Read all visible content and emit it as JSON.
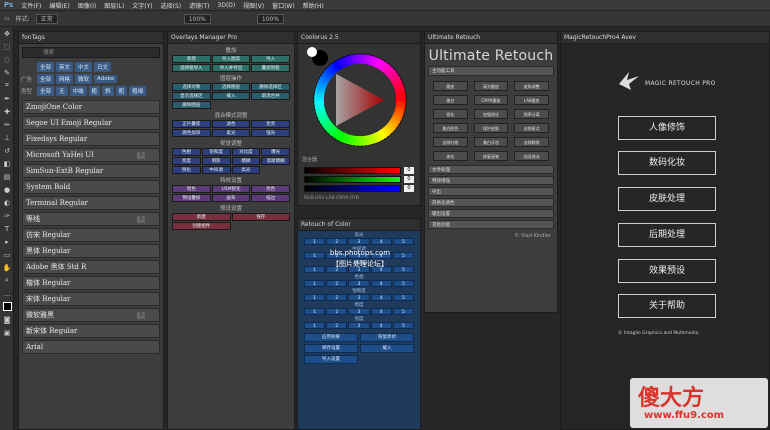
{
  "app": {
    "logo": "Ps"
  },
  "menu": [
    "文件(F)",
    "编辑(E)",
    "图像(I)",
    "图层(L)",
    "文字(Y)",
    "选择(S)",
    "滤镜(T)",
    "3D(D)",
    "视图(V)",
    "窗口(W)",
    "帮助(H)"
  ],
  "options": {
    "size_label": "样式:",
    "size_value": "正常",
    "zoom1": "100%",
    "zoom2": "100%"
  },
  "font_tags": {
    "title": "fonTags",
    "search_placeholder": "搜索",
    "rows": [
      {
        "label": "",
        "tags": [
          "全部",
          "英文",
          "中文",
          "日文"
        ]
      },
      {
        "label": "广告",
        "tags": [
          "全部",
          "网格",
          "微软",
          "Adobe"
        ]
      },
      {
        "label": "类型",
        "tags": [
          "全部",
          "无",
          "中端",
          "粗",
          "斜",
          "粗",
          "粗细"
        ]
      }
    ],
    "fonts": [
      {
        "name": "ZmojiOne Color",
        "badge": ""
      },
      {
        "name": "Segoe UI Emoji Regular",
        "badge": ""
      },
      {
        "name": "Fixedsys Regular",
        "badge": ""
      },
      {
        "name": "Microsoft YaHei UI",
        "badge": "3"
      },
      {
        "name": "SimSun-ExtB Regular",
        "badge": ""
      },
      {
        "name": "System Bold",
        "badge": ""
      },
      {
        "name": "Terminal Regular",
        "badge": ""
      },
      {
        "name": "等线",
        "badge": "3"
      },
      {
        "name": "仿宋 Regular",
        "badge": ""
      },
      {
        "name": "黑体 Regular",
        "badge": ""
      },
      {
        "name": "Adobe 黑体 Std R",
        "badge": ""
      },
      {
        "name": "楷体 Regular",
        "badge": ""
      },
      {
        "name": "宋体 Regular",
        "badge": ""
      },
      {
        "name": "微软雅黑",
        "badge": "3"
      },
      {
        "name": "新宋体 Regular",
        "badge": ""
      },
      {
        "name": "Arial",
        "badge": ""
      }
    ]
  },
  "overlays": {
    "title": "Overlays Manager Pro",
    "sections": [
      {
        "header": "叠加",
        "color": "teal",
        "buttons": [
          "新建",
          "导入图案",
          "导入",
          "选择框导入",
          "导入并导出",
          "叠加到框"
        ]
      },
      {
        "header": "图层操作",
        "color": "tealL",
        "buttons": [
          "选择对象",
          "选择图层",
          "删除选择区",
          "显示选择区",
          "载入",
          "取消合并",
          "删除图层"
        ]
      },
      {
        "header": "混合模式调整",
        "color": "navy",
        "buttons": [
          "正片叠底",
          "滤色",
          "变亮",
          "颜色加深",
          "柔光",
          "强光"
        ]
      },
      {
        "header": "视觉调整",
        "color": "navy",
        "buttons": [
          "色相",
          "饱和度",
          "对比度",
          "曝光",
          "亮度",
          "阴影",
          "模糊",
          "高斯模糊",
          "锐化",
          "中间调",
          "高光"
        ]
      },
      {
        "header": "特效设置",
        "color": "purple",
        "buttons": [
          "暗色",
          "USM锐化",
          "亮色",
          "预设叠加",
          "画布",
          "描边"
        ]
      },
      {
        "header": "预设设置",
        "color": "maroon",
        "buttons": [
          "新建",
          "保存",
          "创建组件"
        ]
      }
    ]
  },
  "coolorus": {
    "title": "Coolorus 2.5",
    "tab": "混合器",
    "mode": "RGB HSV LAB CMYK RYB",
    "values": [
      "0",
      "0",
      "0"
    ]
  },
  "retouch_color": {
    "title": "Retouch of Color",
    "watermark": "bbs.photops.com",
    "subtitle": "【图片处理论坛】",
    "sections": [
      "高光",
      "中间调",
      "阴影",
      "色相",
      "饱和度",
      "明度",
      "亮度"
    ],
    "nums": [
      "1",
      "2",
      "3",
      "4",
      "5"
    ],
    "bottom_buttons": [
      "应用效果",
      "恢复原状",
      "保存设置",
      "载入",
      "导入设置"
    ]
  },
  "ultimate": {
    "title": "Ultimate Retouch",
    "header_text": "主功能工具",
    "buttons": [
      "磨皮",
      "高光磨皮",
      "皮肤调整",
      "美白",
      "CMYK磨皮",
      "LAB磨皮",
      "锐化",
      "加强锐化",
      "频率分离",
      "美白肤色",
      "保护皮肤",
      "去除斑点",
      "去除红眼",
      "美白牙齿",
      "去除眼袋",
      "液化",
      "修复画笔",
      "加深减淡"
    ],
    "footer_items": [
      "文件处理",
      "特效增强",
      "导出",
      "风格化调色",
      "输出设置",
      "其他功能"
    ],
    "credit": "© Vlad Kindler"
  },
  "magic": {
    "title": "MagicRetouchPro4 Avev",
    "brand": "MAGIC RETOUCH PRO",
    "buttons": [
      "人像修饰",
      "数码化妆",
      "皮肤处理",
      "后期处理",
      "效果预设",
      "关于帮助"
    ],
    "credit": "© Intaglio Graphics and Multimedia."
  },
  "site_watermark": {
    "cn": "傻大方",
    "url": "www.ffu9.com"
  },
  "colors": {
    "accent": "#1e4e8a",
    "tag": "#3a5a86",
    "watermark": "#d9342b"
  }
}
